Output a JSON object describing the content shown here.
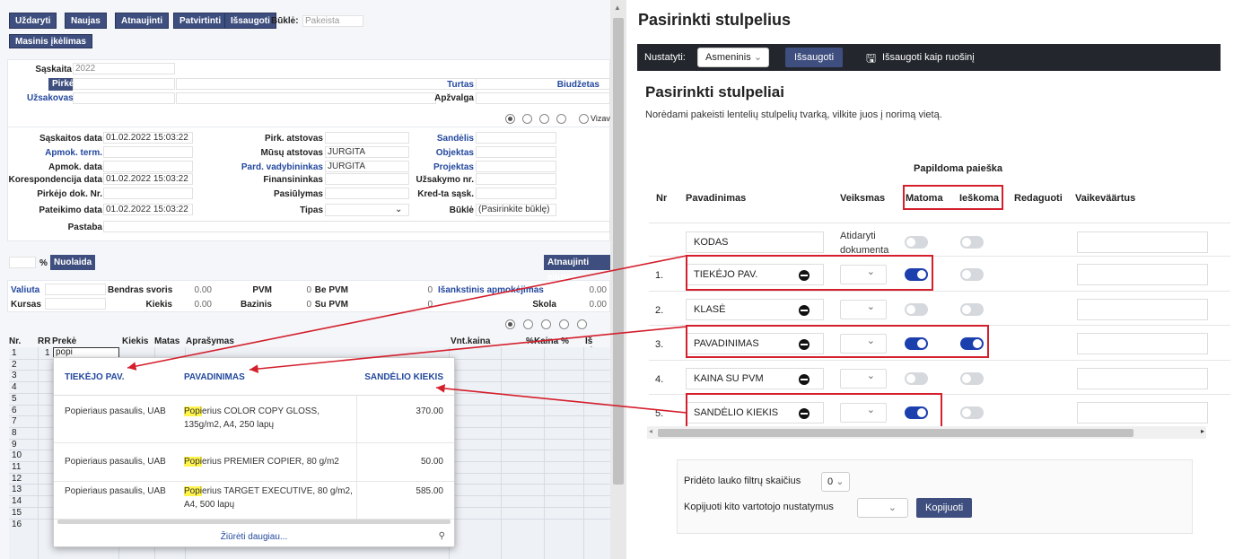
{
  "toolbar": {
    "close": "Uždaryti",
    "new": "Naujas",
    "refresh": "Atnaujinti",
    "confirm": "Patvirtinti",
    "save": "Išsaugoti",
    "status_label": "Būklė:",
    "status_value": "Pakeista",
    "mass_upload": "Masinis įkėlimas"
  },
  "header": {
    "invoice_label": "Sąskaita",
    "invoice_value": "2022",
    "buyer_label": "Pirkėjas",
    "buyer_value": "",
    "orderer_label": "Užsakovas",
    "orderer_value": "",
    "assets_label": "Turtas",
    "budget_label": "Biudžetas",
    "overview_label": "Apžvalga",
    "vizav": "Vizav"
  },
  "details": {
    "inv_date_label": "Sąskaitos data",
    "inv_date": "01.02.2022 15:03:22",
    "pay_term_label": "Apmok. term.",
    "pay_term": "",
    "pay_date_label": "Apmok. data",
    "pay_date": "",
    "corr_date_label": "Korespondencija data",
    "corr_date": "01.02.2022 15:03:22",
    "buyer_doc_label": "Pirkėjo dok. Nr.",
    "buyer_doc": "",
    "submit_date_label": "Pateikimo data",
    "submit_date": "01.02.2022 15:03:22",
    "note_label": "Pastaba",
    "buyer_rep_label": "Pirk. atstovas",
    "buyer_rep": "",
    "our_rep_label": "Mūsų atstovas",
    "our_rep": "JURGITA",
    "sales_mgr_label": "Pard. vadybininkas",
    "sales_mgr": "JURGITA",
    "fin_label": "Finansininkas",
    "fin": "",
    "offer_label": "Pasiūlymas",
    "offer": "",
    "type_label": "Tipas",
    "type": "",
    "warehouse_label": "Sandėlis",
    "object_label": "Objektas",
    "project_label": "Projektas",
    "order_no_label": "Užsakymo nr.",
    "credit_inv_label": "Kred-ta sąsk.",
    "state_label": "Būklė",
    "state_value": "(Pasirinkite būklę)"
  },
  "discount": {
    "percent": "%",
    "button": "Nuolaida",
    "refresh_rows": "Atnaujinti eilutes"
  },
  "totals": {
    "currency_label": "Valiuta",
    "rate_label": "Kursas",
    "gross_weight_label": "Bendras svoris",
    "gross_weight": "0.00",
    "qty_label": "Kiekis",
    "qty": "0.00",
    "vat_label": "PVM",
    "vat": "0",
    "base_label": "Bazinis",
    "base": "0",
    "excl_vat_label": "Be PVM",
    "excl_vat": "0",
    "incl_vat_label": "Su PVM",
    "incl_vat": "0",
    "prepay_label": "Išankstinis apmokėjimas",
    "prepay": "0.00",
    "debt_label": "Skola",
    "debt": "0.00"
  },
  "rows_table": {
    "headers": {
      "nr": "Nr.",
      "rr": "RR",
      "product": "Prekė",
      "qty": "Kiekis",
      "unit": "Matas",
      "desc": "Aprašymas",
      "unit_price": "Vnt.kaina",
      "pct": "%",
      "price_pct": "Kaina %",
      "total": "Iš viso"
    },
    "row_numbers": [
      "1",
      "2",
      "3",
      "4",
      "5",
      "6",
      "7",
      "8",
      "9",
      "10",
      "11",
      "12",
      "13",
      "14",
      "15",
      "16"
    ],
    "first_rr": "1",
    "first_input": "popi"
  },
  "popup": {
    "col_supplier": "TIEKĖJO PAV.",
    "col_name": "PAVADINIMAS",
    "col_stock": "SANDĖLIO KIEKIS",
    "rows": [
      {
        "supplier": "Popieriaus pasaulis, UAB",
        "hl": "Popi",
        "name_rest": "erius COLOR COPY GLOSS, 135g/m2, A4, 250 lapų",
        "stock": "370.00"
      },
      {
        "supplier": "Popieriaus pasaulis, UAB",
        "hl": "Popi",
        "name_rest": "erius PREMIER COPIER, 80 g/m2",
        "stock": "50.00"
      },
      {
        "supplier": "Popieriaus pasaulis, UAB",
        "hl": "Popi",
        "name_rest": "erius TARGET EXECUTIVE, 80 g/m2, A4, 500 lapų",
        "stock": "585.00"
      }
    ],
    "more": "Žiūrėti daugiau..."
  },
  "right": {
    "title": "Pasirinkti stulpelius",
    "set_label": "Nustatyti:",
    "set_value": "Asmeninis",
    "save": "Išsaugoti",
    "save_template": "Išsaugoti kaip ruošinį",
    "h2": "Pasirinkti stulpeliai",
    "desc": "Norėdami pakeisti lentelių stulpelių tvarką, vilkite juos į norimą vietą.",
    "extra_search": "Papildoma paieška",
    "th_nr": "Nr",
    "th_name": "Pavadinimas",
    "th_action": "Veiksmas",
    "th_visible": "Matoma",
    "th_searched": "Ieškoma",
    "th_edit": "Redaguoti",
    "th_default": "Vaikeväärtus",
    "kodas": "KODAS",
    "kodas_action": "Atidaryti dokumenta",
    "rows": [
      {
        "nr": "1.",
        "name": "TIEKĖJO PAV.",
        "visible": true,
        "searched": false
      },
      {
        "nr": "2.",
        "name": "KLASĖ",
        "visible": false,
        "searched": false
      },
      {
        "nr": "3.",
        "name": "PAVADINIMAS",
        "visible": true,
        "searched": true
      },
      {
        "nr": "4.",
        "name": "KAINA SU PVM",
        "visible": false,
        "searched": false
      },
      {
        "nr": "5.",
        "name": "SANDĖLIO KIEKIS",
        "visible": true,
        "searched": false
      }
    ],
    "filter_count_label": "Pridėto lauko filtrų skaičius",
    "filter_count": "0",
    "copy_label": "Kopijuoti kito vartotojo nustatymus",
    "copy_btn": "Kopijuoti"
  },
  "colors": {
    "nav": "#3e4e7e",
    "link": "#23489e",
    "bar": "#23262d",
    "toggle_on": "#1c3fae",
    "red": "#d41f2c",
    "highlight": "#fff34d"
  }
}
